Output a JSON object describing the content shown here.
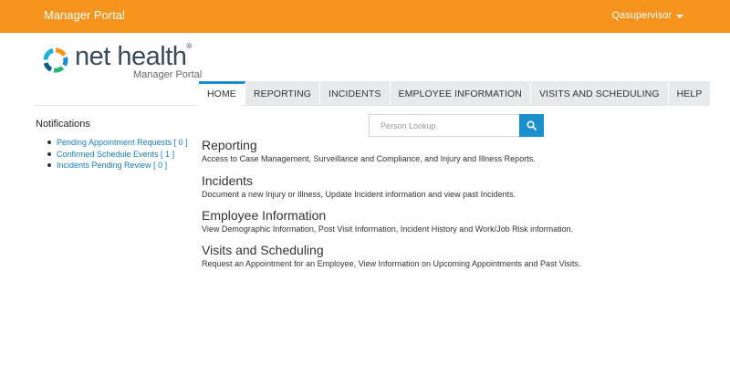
{
  "header": {
    "app_title": "Manager Portal",
    "user_name": "Qasupervisor",
    "accent_color": "#f7941d"
  },
  "logo": {
    "name": "net health",
    "subtitle": "Manager Portal"
  },
  "nav": {
    "active_color": "#1a8fce",
    "tabs": [
      {
        "label": "HOME",
        "active": true
      },
      {
        "label": "REPORTING",
        "active": false
      },
      {
        "label": "INCIDENTS",
        "active": false
      },
      {
        "label": "EMPLOYEE INFORMATION",
        "active": false
      },
      {
        "label": "VISITS AND SCHEDULING",
        "active": false
      },
      {
        "label": "HELP",
        "active": false
      }
    ]
  },
  "notifications": {
    "title": "Notifications",
    "items": [
      "Pending Appointment Requests [ 0 ]",
      "Confirmed Schedule Events [ 1 ]",
      "Incidents Pending Review [ 0 ]"
    ]
  },
  "search": {
    "placeholder": "Person Lookup",
    "button_icon": "search-icon"
  },
  "sections": [
    {
      "title": "Reporting",
      "description": "Access to Case Management, Surveillance and Compliance, and Injury and Illness Reports."
    },
    {
      "title": "Incidents",
      "description": "Document a new Injury or Illness, Update Incident information and view past Incidents."
    },
    {
      "title": "Employee Information",
      "description": "View Demographic Information, Post Visit Information, Incident History and Work/Job Risk information."
    },
    {
      "title": "Visits and Scheduling",
      "description": "Request an Appointment for an Employee, View Information on Upcoming Appointments and Past Visits."
    }
  ]
}
